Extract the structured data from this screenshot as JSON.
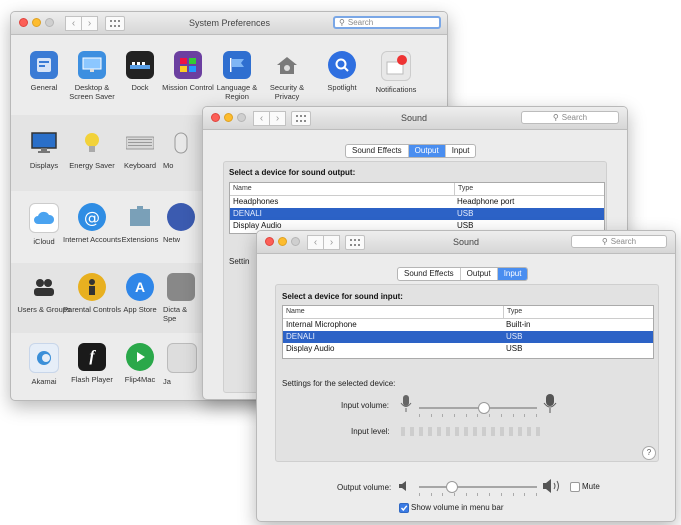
{
  "prefs_window": {
    "title": "System Preferences",
    "search_placeholder": "Search",
    "row1": [
      {
        "label": "General",
        "icon": "general-icon",
        "color": "#3a7bd5"
      },
      {
        "label": "Desktop & Screen Saver",
        "icon": "desktop-icon",
        "color": "#3d8fe0"
      },
      {
        "label": "Dock",
        "icon": "dock-icon",
        "color": "#222222"
      },
      {
        "label": "Mission Control",
        "icon": "mission-control-icon",
        "color": "#6b3fa0"
      },
      {
        "label": "Language & Region",
        "icon": "flag-icon",
        "color": "#2f6fd0"
      },
      {
        "label": "Security & Privacy",
        "icon": "house-icon",
        "color": "#7a7a7a"
      },
      {
        "label": "Spotlight",
        "icon": "spotlight-icon",
        "color": "#2f6fe0"
      },
      {
        "label": "Notifications",
        "icon": "notifications-icon",
        "color": "#d33"
      }
    ],
    "row2": [
      {
        "label": "Displays",
        "icon": "display-icon",
        "color": "#2a6fc9"
      },
      {
        "label": "Energy Saver",
        "icon": "bulb-icon",
        "color": "#f2d23a"
      },
      {
        "label": "Keyboard",
        "icon": "keyboard-icon",
        "color": "#9a9a9a"
      },
      {
        "label": "Mo",
        "icon": "mouse-icon",
        "color": "#9a9a9a"
      }
    ],
    "row3": [
      {
        "label": "iCloud",
        "icon": "cloud-icon",
        "color": "#4aa3f0"
      },
      {
        "label": "Internet Accounts",
        "icon": "at-icon",
        "color": "#2f8de4"
      },
      {
        "label": "Extensions",
        "icon": "puzzle-icon",
        "color": "#7aa0b8"
      },
      {
        "label": "Netw",
        "icon": "globe-icon",
        "color": "#3b5bb0"
      }
    ],
    "row4": [
      {
        "label": "Users & Groups",
        "icon": "users-icon",
        "color": "#333333"
      },
      {
        "label": "Parental Controls",
        "icon": "parental-icon",
        "color": "#e8b020"
      },
      {
        "label": "App Store",
        "icon": "appstore-icon",
        "color": "#2f86e8"
      },
      {
        "label": "Dicta & Spe",
        "icon": "microphone-icon",
        "color": "#888888"
      }
    ],
    "row5": [
      {
        "label": "Akamai",
        "icon": "akamai-icon",
        "color": "#3b8fd8"
      },
      {
        "label": "Flash Player",
        "icon": "flash-icon",
        "color": "#1a1a1a"
      },
      {
        "label": "Flip4Mac",
        "icon": "play-icon",
        "color": "#2aa84a"
      },
      {
        "label": "Ja",
        "icon": "java-icon",
        "color": "#bbbbbb"
      }
    ]
  },
  "sound_output_window": {
    "title": "Sound",
    "search_placeholder": "Search",
    "tabs": [
      "Sound Effects",
      "Output",
      "Input"
    ],
    "selected_tab": "Output",
    "section_title": "Select a device for sound output:",
    "col_name": "Name",
    "col_type": "Type",
    "rows": [
      {
        "name": "Headphones",
        "type": "Headphone port"
      },
      {
        "name": "DENALI",
        "type": "USB"
      },
      {
        "name": "Display Audio",
        "type": "USB"
      }
    ],
    "settings_label": "Settin"
  },
  "sound_input_window": {
    "title": "Sound",
    "search_placeholder": "Search",
    "tabs": [
      "Sound Effects",
      "Output",
      "Input"
    ],
    "selected_tab": "Input",
    "section_title": "Select a device for sound input:",
    "col_name": "Name",
    "col_type": "Type",
    "rows": [
      {
        "name": "Internal Microphone",
        "type": "Built-in"
      },
      {
        "name": "DENALI",
        "type": "USB"
      },
      {
        "name": "Display Audio",
        "type": "USB"
      }
    ],
    "settings_label": "Settings for the selected device:",
    "input_volume_label": "Input volume:",
    "input_level_label": "Input level:",
    "input_volume_value": 0.55,
    "output_volume_label": "Output volume:",
    "output_volume_value": 0.28,
    "mute_label": "Mute",
    "mute_checked": false,
    "show_volume_label": "Show volume in menu bar",
    "show_volume_checked": true,
    "help": "?"
  }
}
